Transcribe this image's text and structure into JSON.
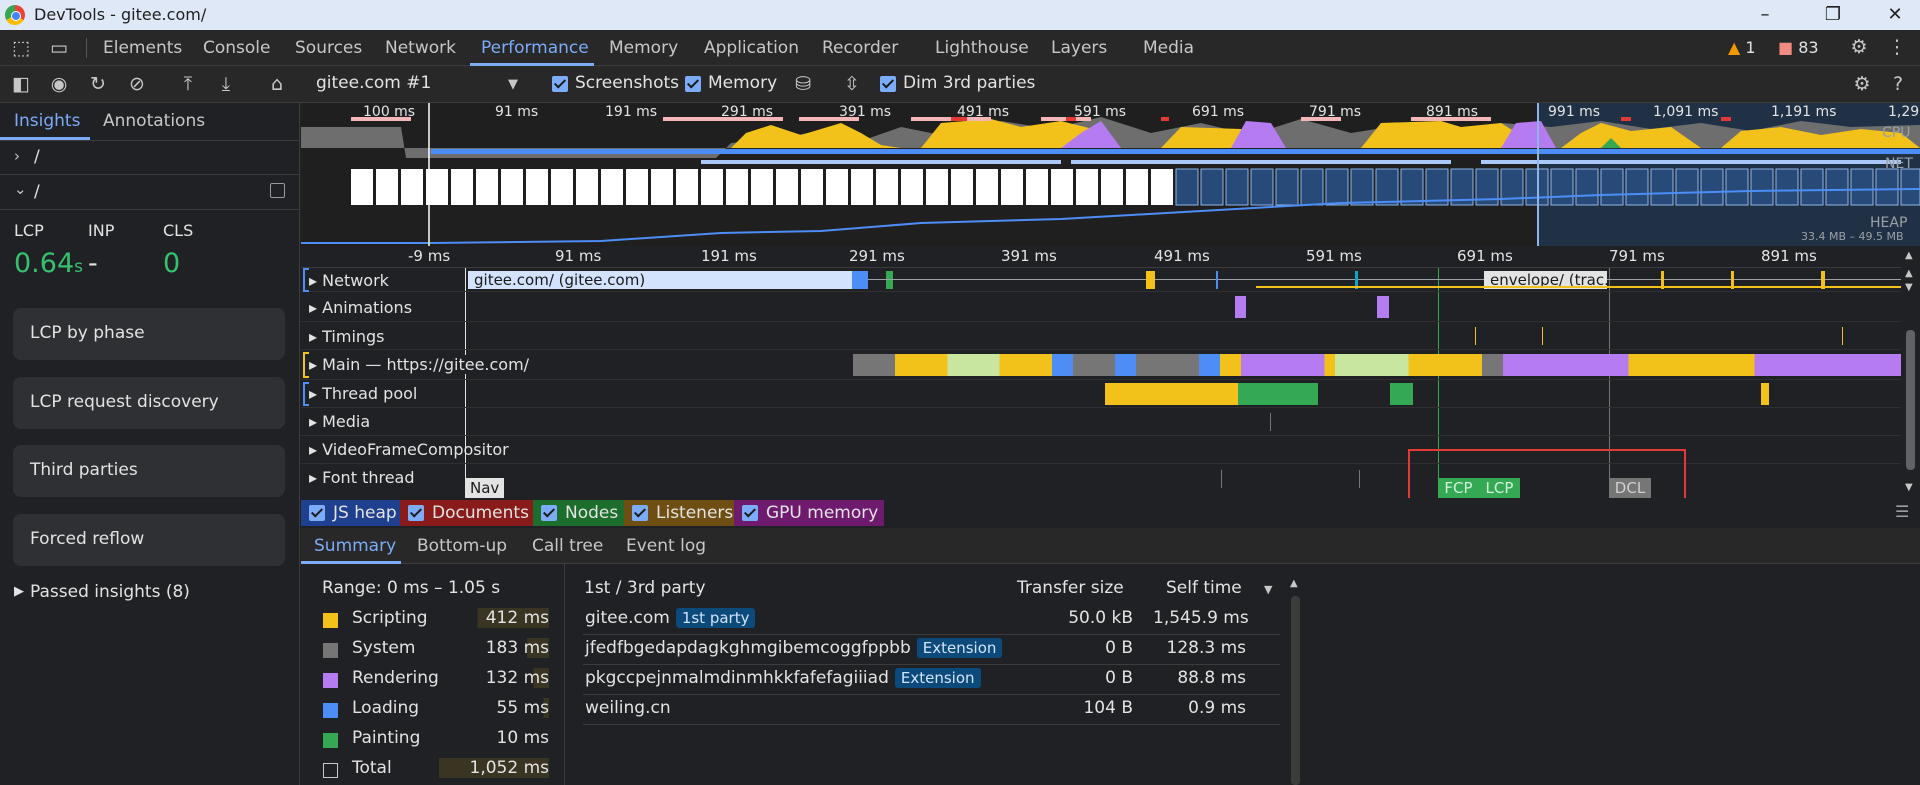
{
  "window": {
    "title": "DevTools - gitee.com/"
  },
  "tabs": [
    "Elements",
    "Console",
    "Sources",
    "Network",
    "Performance",
    "Memory",
    "Application",
    "Recorder",
    "Lighthouse",
    "Layers",
    "Media"
  ],
  "active_tab": "Performance",
  "status": {
    "warnings": "1",
    "issues": "83"
  },
  "toolbar": {
    "recording": "gitee.com #1",
    "screenshots": "Screenshots",
    "memory": "Memory",
    "dim": "Dim 3rd parties"
  },
  "sidebar": {
    "tabs": [
      "Insights",
      "Annotations"
    ],
    "tree_closed": "/",
    "tree_open": "/",
    "metrics": [
      {
        "label": "LCP",
        "value": "0.64",
        "unit": "s"
      },
      {
        "label": "INP",
        "value": "-",
        "unit": ""
      },
      {
        "label": "CLS",
        "value": "0",
        "unit": ""
      }
    ],
    "cards": [
      "LCP by phase",
      "LCP request discovery",
      "Third parties",
      "Forced reflow"
    ],
    "passed": "Passed insights (8)"
  },
  "overview": {
    "ticks": [
      "100 ms",
      "91 ms",
      "191 ms",
      "291 ms",
      "391 ms",
      "491 ms",
      "591 ms",
      "691 ms",
      "791 ms",
      "891 ms",
      "991 ms",
      "1,091 ms",
      "1,191 ms",
      "1,29"
    ],
    "cpu": "CPU",
    "net": "NET",
    "heap": "HEAP",
    "heap_range": "33.4 MB – 49.5 MB"
  },
  "timeline": {
    "ticks": [
      "-9 ms",
      "91 ms",
      "191 ms",
      "291 ms",
      "391 ms",
      "491 ms",
      "591 ms",
      "691 ms",
      "791 ms",
      "891 ms"
    ],
    "tracks": [
      "Network",
      "Animations",
      "Timings",
      "Main — https://gitee.com/",
      "Thread pool",
      "Media",
      "VideoFrameCompositor",
      "Font thread"
    ],
    "network_req1": "gitee.com/ (gitee.com)",
    "network_req2": "envelope/ (trac...",
    "markers": {
      "nav": "Nav",
      "fcp": "FCP",
      "lcp": "LCP",
      "dcl": "DCL"
    }
  },
  "counters": [
    {
      "label": "JS heap",
      "color": "#1f3f8f"
    },
    {
      "label": "Documents",
      "color": "#8a1b1b"
    },
    {
      "label": "Nodes",
      "color": "#1b6e2b"
    },
    {
      "label": "Listeners",
      "color": "#6e4e12"
    },
    {
      "label": "GPU memory",
      "color": "#6e1a6e"
    }
  ],
  "detail_tabs": [
    "Summary",
    "Bottom-up",
    "Call tree",
    "Event log"
  ],
  "summary": {
    "range": "Range: 0 ms – 1.05 s",
    "categories": [
      {
        "name": "Scripting",
        "value": "412 ms",
        "color": "#f2c21a"
      },
      {
        "name": "System",
        "value": "183 ms",
        "color": "#767676"
      },
      {
        "name": "Rendering",
        "value": "132 ms",
        "color": "#b57cf2"
      },
      {
        "name": "Loading",
        "value": "55 ms",
        "color": "#4c8df6"
      },
      {
        "name": "Painting",
        "value": "10 ms",
        "color": "#34a853"
      },
      {
        "name": "Total",
        "value": "1,052 ms",
        "color": "#202124"
      }
    ]
  },
  "party_table": {
    "headers": [
      "1st / 3rd party",
      "Transfer size",
      "Self time"
    ],
    "rows": [
      {
        "name": "gitee.com",
        "badge": "1st party",
        "size": "50.0 kB",
        "time": "1,545.9 ms"
      },
      {
        "name": "jfedfbgedapdagkghmgibemcoggfppbb",
        "badge": "Extension",
        "size": "0 B",
        "time": "128.3 ms"
      },
      {
        "name": "pkgccpejnmalmdinmhkkfafefagiiiad",
        "badge": "Extension",
        "size": "0 B",
        "time": "88.8 ms"
      },
      {
        "name": "weiling.cn",
        "badge": "",
        "size": "104 B",
        "time": "0.9 ms"
      }
    ]
  }
}
